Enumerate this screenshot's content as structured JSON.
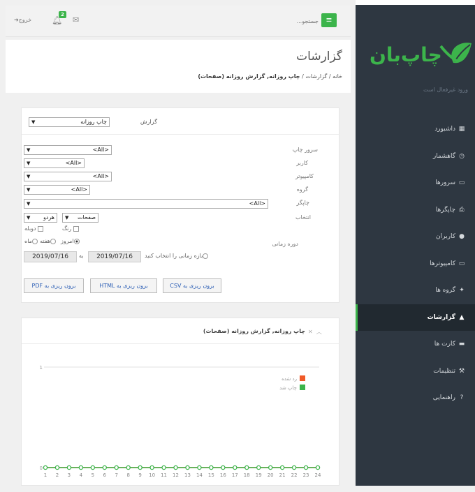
{
  "sidebar": {
    "status_text": "ورود غیرفعال است",
    "items": [
      {
        "label": "داشبورد",
        "icon": "dashboard-icon",
        "glyph": "▦"
      },
      {
        "label": "گاهشمار",
        "icon": "clock-icon",
        "glyph": "◷"
      },
      {
        "label": "سرورها",
        "icon": "server-icon",
        "glyph": "▭"
      },
      {
        "label": "چاپگرها",
        "icon": "printer-icon",
        "glyph": "⎙"
      },
      {
        "label": "کاربران",
        "icon": "user-icon",
        "glyph": "●"
      },
      {
        "label": "کامپیوترها",
        "icon": "monitor-icon",
        "glyph": "▭"
      },
      {
        "label": "گروه ها",
        "icon": "group-icon",
        "glyph": "✦"
      },
      {
        "label": "گزارشات",
        "icon": "chart-icon",
        "glyph": "▲"
      },
      {
        "label": "کارت ها",
        "icon": "card-icon",
        "glyph": "▬"
      },
      {
        "label": "تنظیمات",
        "icon": "wrench-icon",
        "glyph": "⚒"
      },
      {
        "label": "راهنمایی",
        "icon": "question-icon",
        "glyph": "?"
      }
    ],
    "active_index": 7
  },
  "topbar": {
    "search_placeholder": "جستجو...",
    "logout_label": "خروج",
    "notification_count": "2"
  },
  "page": {
    "title": "گزارشات",
    "breadcrumb": {
      "home": "خانه",
      "reports": "گزارشات",
      "current": "چاپ روزانه, گزارش روزانه (صفحات)"
    }
  },
  "filters": {
    "report_label": "گزارش",
    "report_value": "چاپ روزانه",
    "print_server_label": "سرور چاپ",
    "print_server_value": "<All>",
    "user_label": "کاربر",
    "user_value": "<All>",
    "computer_label": "کامپیوتر",
    "computer_value": "<All>",
    "group_label": "گروه",
    "group_value": "<All>",
    "printer_label": "چاپگر",
    "printer_value": "<All>",
    "select_label": "انتخاب",
    "select_value1": "صفحات",
    "select_value2": "هردو",
    "color_label": "رنگ",
    "duplex_label": "دوبله",
    "period_label": "دوره زمانی",
    "today_label": "امروز",
    "week_label": "هفته",
    "month_label": "ماه",
    "custom_label": "بازه زمانی را انتخاب کنید",
    "to_label": "به",
    "date_from": "2019/07/16",
    "date_to": "2019/07/16"
  },
  "export": {
    "csv": "برون ریزی به CSV",
    "html": "برون ریزی به HTML",
    "pdf": "برون ریزی به PDF"
  },
  "chart_panel": {
    "title": "چاپ روزانه, گزارش روزانه (صفحات)"
  },
  "chart_data": {
    "type": "line",
    "x": [
      1,
      2,
      3,
      4,
      5,
      6,
      7,
      8,
      9,
      10,
      11,
      12,
      13,
      14,
      15,
      16,
      17,
      18,
      19,
      20,
      21,
      22,
      23,
      24
    ],
    "series": [
      {
        "name": "چاپ شد",
        "color": "#3cb44b",
        "values": [
          0,
          0,
          0,
          0,
          0,
          0,
          0,
          0,
          0,
          0,
          0,
          0,
          0,
          0,
          0,
          0,
          0,
          0,
          0,
          0,
          0,
          0,
          0,
          0
        ]
      },
      {
        "name": "رد شده",
        "color": "#f05a28",
        "values": [
          0,
          0,
          0,
          0,
          0,
          0,
          0,
          0,
          0,
          0,
          0,
          0,
          0,
          0,
          0,
          0,
          0,
          0,
          0,
          0,
          0,
          0,
          0,
          0
        ]
      }
    ],
    "ylim": [
      0,
      1
    ],
    "yticks": [
      "0",
      "1"
    ],
    "grid": true,
    "legend": "top-right"
  }
}
